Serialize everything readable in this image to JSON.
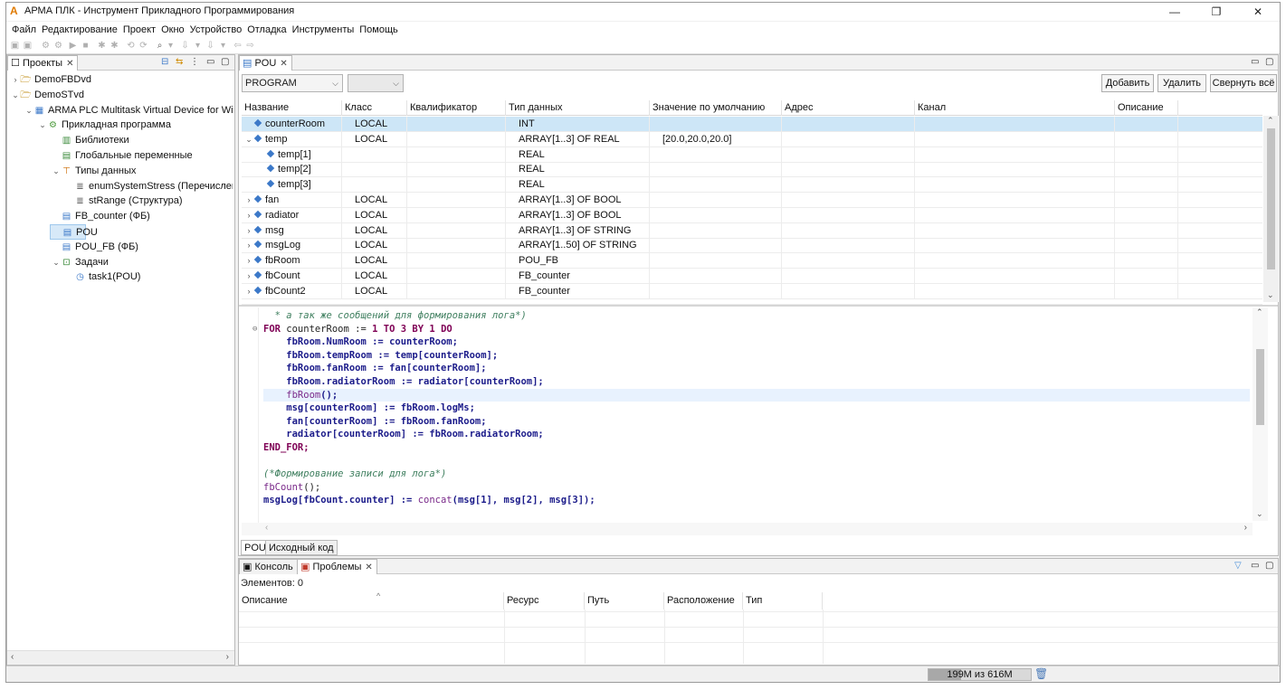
{
  "window": {
    "title": "АРМА ПЛК - Инструмент Прикладного Программирования",
    "minimize": "—",
    "maximize": "❐",
    "close": "✕"
  },
  "menu": [
    "Файл",
    "Редактирование",
    "Проект",
    "Окно",
    "Устройство",
    "Отладка",
    "Инструменты",
    "Помощь"
  ],
  "projects_panel": {
    "tab_label": "Проекты",
    "tree": [
      {
        "label": "DemoFBDvd",
        "indent": 0,
        "twisty": "›",
        "icon": "folder-icon"
      },
      {
        "label": "DemoSTvd",
        "indent": 0,
        "twisty": "⌄",
        "icon": "folder-icon"
      },
      {
        "label": "ARMA PLC Multitask Virtual Device for Wi",
        "indent": 1,
        "twisty": "⌄",
        "icon": "device-icon"
      },
      {
        "label": "Прикладная программа",
        "indent": 2,
        "twisty": "⌄",
        "icon": "gear-icon"
      },
      {
        "label": "Библиотеки",
        "indent": 3,
        "twisty": "",
        "icon": "library-icon"
      },
      {
        "label": "Глобальные переменные",
        "indent": 3,
        "twisty": "",
        "icon": "variables-icon"
      },
      {
        "label": "Типы данных",
        "indent": 3,
        "twisty": "⌄",
        "icon": "types-icon"
      },
      {
        "label": "enumSystemStress (Перечислен",
        "indent": 4,
        "twisty": "",
        "icon": "enum-icon"
      },
      {
        "label": "stRange (Структура)",
        "indent": 4,
        "twisty": "",
        "icon": "struct-icon"
      },
      {
        "label": "FB_counter (ФБ)",
        "indent": 3,
        "twisty": "",
        "icon": "file-icon"
      },
      {
        "label": "POU",
        "indent": 3,
        "twisty": "",
        "icon": "file-icon",
        "selected": true
      },
      {
        "label": "POU_FB (ФБ)",
        "indent": 3,
        "twisty": "",
        "icon": "file-icon"
      },
      {
        "label": "Задачи",
        "indent": 3,
        "twisty": "⌄",
        "icon": "tasks-icon"
      },
      {
        "label": "task1(POU)",
        "indent": 4,
        "twisty": "",
        "icon": "task-icon"
      }
    ]
  },
  "editor": {
    "tab_label": "POU",
    "pou_type": "PROGRAM",
    "second_combo": "",
    "buttons": {
      "add": "Добавить",
      "delete": "Удалить",
      "collapse": "Свернуть всё"
    },
    "columns": [
      "Название",
      "Класс",
      "Квалификатор",
      "Тип данных",
      "Значение по умолчанию",
      "Адрес",
      "Канал",
      "Описание"
    ],
    "rows": [
      {
        "name": "counterRoom",
        "class": "LOCAL",
        "type": "INT",
        "default": "",
        "twisty": "",
        "indent": 0,
        "selected": true
      },
      {
        "name": "temp",
        "class": "LOCAL",
        "type": "ARRAY[1..3] OF REAL",
        "default": "[20.0,20.0,20.0]",
        "twisty": "⌄",
        "indent": 0
      },
      {
        "name": "temp[1]",
        "class": "",
        "type": "REAL",
        "default": "",
        "twisty": "",
        "indent": 1
      },
      {
        "name": "temp[2]",
        "class": "",
        "type": "REAL",
        "default": "",
        "twisty": "",
        "indent": 1
      },
      {
        "name": "temp[3]",
        "class": "",
        "type": "REAL",
        "default": "",
        "twisty": "",
        "indent": 1
      },
      {
        "name": "fan",
        "class": "LOCAL",
        "type": "ARRAY[1..3] OF BOOL",
        "default": "",
        "twisty": "›",
        "indent": 0
      },
      {
        "name": "radiator",
        "class": "LOCAL",
        "type": "ARRAY[1..3] OF BOOL",
        "default": "",
        "twisty": "›",
        "indent": 0
      },
      {
        "name": "msg",
        "class": "LOCAL",
        "type": "ARRAY[1..3] OF STRING",
        "default": "",
        "twisty": "›",
        "indent": 0
      },
      {
        "name": "msgLog",
        "class": "LOCAL",
        "type": "ARRAY[1..50] OF STRING",
        "default": "",
        "twisty": "›",
        "indent": 0
      },
      {
        "name": "fbRoom",
        "class": "LOCAL",
        "type": "POU_FB",
        "default": "",
        "twisty": "›",
        "indent": 0
      },
      {
        "name": "fbCount",
        "class": "LOCAL",
        "type": "FB_counter",
        "default": "",
        "twisty": "›",
        "indent": 0
      },
      {
        "name": "fbCount2",
        "class": "LOCAL",
        "type": "FB_counter",
        "default": "",
        "twisty": "›",
        "indent": 0
      }
    ],
    "code_lines": [
      [
        {
          "t": "cm",
          "s": "  * а так же сообщений для формирования лога*)"
        }
      ],
      [
        {
          "t": "kw",
          "s": "FOR"
        },
        {
          "t": "pl",
          "s": " counterRoom := "
        },
        {
          "t": "kw",
          "s": "1"
        },
        {
          "t": "pl",
          "s": " "
        },
        {
          "t": "kw",
          "s": "TO"
        },
        {
          "t": "pl",
          "s": " "
        },
        {
          "t": "kw",
          "s": "3"
        },
        {
          "t": "pl",
          "s": " "
        },
        {
          "t": "kw",
          "s": "BY"
        },
        {
          "t": "pl",
          "s": " "
        },
        {
          "t": "kw",
          "s": "1"
        },
        {
          "t": "pl",
          "s": " "
        },
        {
          "t": "kw",
          "s": "DO"
        }
      ],
      [
        {
          "t": "id",
          "s": "    fbRoom.NumRoom := counterRoom;"
        }
      ],
      [
        {
          "t": "id",
          "s": "    fbRoom.tempRoom := temp[counterRoom];"
        }
      ],
      [
        {
          "t": "id",
          "s": "    fbRoom.fanRoom := fan[counterRoom];"
        }
      ],
      [
        {
          "t": "id",
          "s": "    fbRoom.radiatorRoom := radiator[counterRoom];"
        }
      ],
      [
        {
          "t": "fn",
          "s": "    fbRoom"
        },
        {
          "t": "id",
          "s": "();"
        }
      ],
      [
        {
          "t": "id",
          "s": "    msg[counterRoom] := fbRoom.logMs;"
        }
      ],
      [
        {
          "t": "id",
          "s": "    fan[counterRoom] := fbRoom.fanRoom;"
        }
      ],
      [
        {
          "t": "id",
          "s": "    radiator[counterRoom] := fbRoom.radiatorRoom;"
        }
      ],
      [
        {
          "t": "kw",
          "s": "END_FOR;"
        }
      ],
      [
        {
          "t": "pl",
          "s": ""
        }
      ],
      [
        {
          "t": "cm",
          "s": "(*Формирование записи для лога*)"
        }
      ],
      [
        {
          "t": "fn",
          "s": "fbCount"
        },
        {
          "t": "pl",
          "s": "();"
        }
      ],
      [
        {
          "t": "id",
          "s": "msgLog[fbCount.counter] := "
        },
        {
          "t": "fn",
          "s": "concat"
        },
        {
          "t": "id",
          "s": "(msg[1], msg[2], msg[3]);"
        }
      ]
    ],
    "bottom_tabs": [
      "POU",
      "Исходный код"
    ]
  },
  "console": {
    "tab_console": "Консоль",
    "tab_problems": "Проблемы",
    "count_label": "Элементов: 0",
    "columns": [
      "Описание",
      "Ресурс",
      "Путь",
      "Расположение",
      "Тип"
    ],
    "sort_indicator": "^"
  },
  "status": {
    "heap": "199M из 616M",
    "heap_fraction": 0.323
  }
}
